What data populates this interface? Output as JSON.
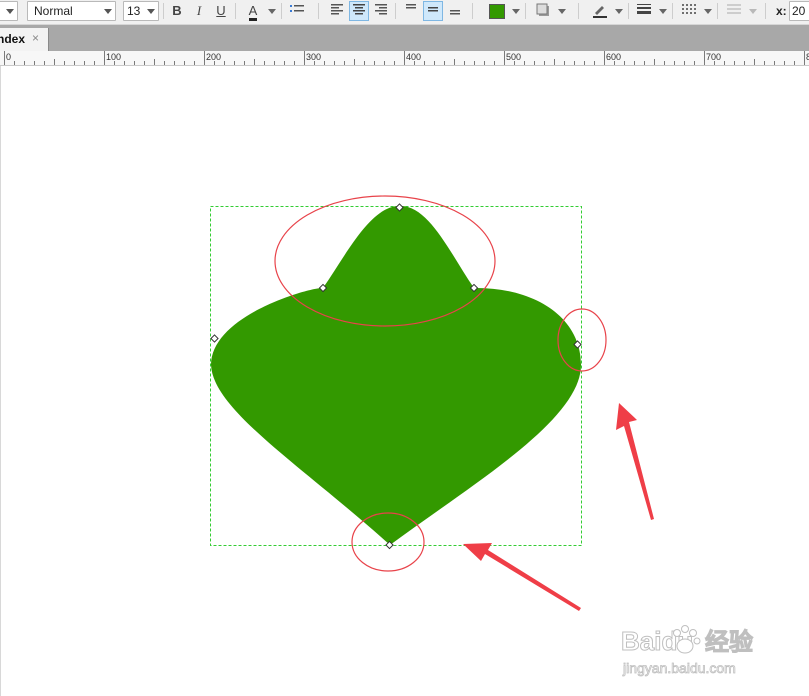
{
  "toolbar": {
    "style_value": "Normal",
    "font_size_value": "13",
    "bold_label": "B",
    "italic_label": "I",
    "underline_label": "U",
    "font_color_label": "A",
    "x_label": "x:",
    "x_value": "20",
    "fill_color": "#339900",
    "align_center_active": true,
    "valign_middle_active": true
  },
  "tabs": [
    {
      "label": "ndex",
      "close": "×"
    }
  ],
  "ruler": {
    "ticks": [
      "0",
      "100",
      "200",
      "300",
      "400",
      "500",
      "600",
      "700",
      "80"
    ]
  },
  "shape": {
    "fill": "#339900",
    "selection_color": "#33cc33",
    "annotation_color": "#e8434a"
  },
  "watermark": {
    "brand": "Baidu",
    "brand_cn": "经验",
    "url": "jingyan.baidu.com"
  }
}
